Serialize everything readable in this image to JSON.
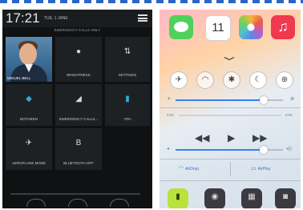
{
  "colors": {
    "accent_dashes": "#2a66c8",
    "android_bg": "#0f1112",
    "ios_slider": "#3b7ff0",
    "torch_on": "#b8e33b"
  },
  "android": {
    "status": {
      "time": "17:21",
      "date": "TUE, 1 JANE"
    },
    "carrier": "EMERGENCY CALLS ONLY",
    "profile_name": "MIGUEL BELL",
    "tiles": [
      {
        "label": "BRIGHTNESS",
        "icon": "brightness-icon",
        "glyph": "●"
      },
      {
        "label": "SETTINGS",
        "icon": "settings-icon",
        "glyph": "⇅"
      },
      {
        "label": "BOTHEEN",
        "icon": "wifi-icon",
        "glyph": "◆"
      },
      {
        "label": "EMERGENCY CALLS...",
        "icon": "signal-icon",
        "glyph": "◢"
      },
      {
        "label": "70%",
        "icon": "battery-icon",
        "glyph": "▮"
      },
      {
        "label": "AEROPLANE MODE",
        "icon": "airplane-icon",
        "glyph": "✈"
      },
      {
        "label": "BLUETOOTH OFF",
        "icon": "bluetooth-icon",
        "glyph": "B"
      }
    ]
  },
  "ios": {
    "apps": [
      {
        "name": "messages-icon"
      },
      {
        "name": "calendar-icon",
        "day": "11"
      },
      {
        "name": "photos-icon"
      },
      {
        "name": "music-icon",
        "glyph": "♫"
      }
    ],
    "toggles": [
      {
        "name": "airplane-toggle",
        "glyph": "✈",
        "on": true
      },
      {
        "name": "wifi-toggle",
        "glyph": "◠",
        "on": false
      },
      {
        "name": "bluetooth-toggle",
        "glyph": "✱",
        "on": false
      },
      {
        "name": "dnd-toggle",
        "glyph": "☾",
        "on": true
      },
      {
        "name": "rotation-lock-toggle",
        "glyph": "⊕",
        "on": true
      }
    ],
    "brightness": {
      "value": 0.82,
      "low_glyph": "☀",
      "high_glyph": "☀"
    },
    "scrubber": {
      "elapsed": "0:00",
      "remaining": "0:00",
      "value": 0.0
    },
    "playback": {
      "prev": "◀◀",
      "play": "▶",
      "next": "▶▶"
    },
    "volume": {
      "value": 0.82,
      "low_glyph": "◂",
      "high_glyph": "◂))"
    },
    "airdrop": {
      "label": "AirDrop",
      "glyph": "◠"
    },
    "airplay": {
      "label": "AirPlay",
      "glyph": "▭"
    },
    "tools": [
      {
        "name": "flashlight-icon",
        "glyph": "▮",
        "on": true
      },
      {
        "name": "timer-icon",
        "glyph": "◉",
        "on": false
      },
      {
        "name": "calculator-icon",
        "glyph": "▦",
        "on": false
      },
      {
        "name": "camera-icon",
        "glyph": "◙",
        "on": false
      }
    ]
  }
}
